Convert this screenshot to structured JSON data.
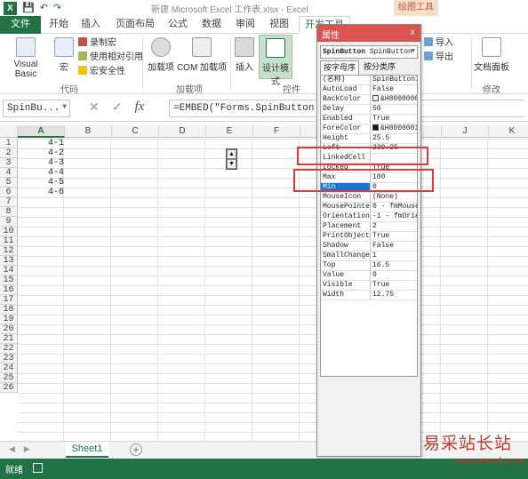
{
  "window": {
    "title": "新建 Microsoft Excel 工作表.xlsx - Excel",
    "context_tab_group": "绘图工具"
  },
  "tabs": [
    "文件",
    "开始",
    "插入",
    "页面布局",
    "公式",
    "数据",
    "审阅",
    "视图",
    "开发工具"
  ],
  "ribbon": {
    "code_group": {
      "visual_basic": "Visual Basic",
      "macros": "宏",
      "record_macro": "录制宏",
      "relative_ref": "使用相对引用",
      "macro_security": "宏安全性",
      "label": "代码"
    },
    "addins_group": {
      "addins": "加载项",
      "com_addins": "COM 加载项",
      "label": "加载项"
    },
    "controls_group": {
      "insert": "插入",
      "design_mode": "设计模式",
      "label": "控件"
    },
    "xml_group": {
      "import": "导入",
      "export": "导出"
    },
    "modify_group": {
      "doc_panel": "文档面板",
      "label": "修改"
    }
  },
  "formula_bar": {
    "name_box": "SpinBu...",
    "formula": "=EMBED(\"Forms.SpinButton.1\",\"\")"
  },
  "grid": {
    "columns": [
      "A",
      "B",
      "C",
      "D",
      "E",
      "F",
      "G",
      "H",
      "I",
      "J",
      "K"
    ],
    "rows": [
      "1",
      "2",
      "3",
      "4",
      "5",
      "6",
      "7",
      "8",
      "9",
      "10",
      "11",
      "12",
      "13",
      "14",
      "15",
      "16",
      "17",
      "18",
      "19",
      "20",
      "21",
      "22",
      "23",
      "24",
      "25",
      "26"
    ],
    "col_a_values": [
      "4-1",
      "4-2",
      "4-3",
      "4-4",
      "4-5",
      "4-6"
    ]
  },
  "sheets": {
    "active": "Sheet1",
    "add": "+"
  },
  "status": {
    "ready": "就绪"
  },
  "properties": {
    "title": "属性",
    "close": "x",
    "object_name": "SpinButton",
    "object_type": "SpinButton",
    "tab_alpha": "按字母序",
    "tab_category": "按分类序",
    "rows": [
      {
        "name": "(名称)",
        "value": "SpinButton1"
      },
      {
        "name": "AutoLoad",
        "value": "False"
      },
      {
        "name": "BackColor",
        "value": "&H8000000"
      },
      {
        "name": "Delay",
        "value": "50"
      },
      {
        "name": "Enabled",
        "value": "True"
      },
      {
        "name": "ForeColor",
        "value": "&H8000001"
      },
      {
        "name": "Height",
        "value": "25.5"
      },
      {
        "name": "Left",
        "value": "239.25"
      },
      {
        "name": "LinkedCell",
        "value": ""
      },
      {
        "name": "Locked",
        "value": "True"
      },
      {
        "name": "Max",
        "value": "100"
      },
      {
        "name": "Min",
        "value": "0"
      },
      {
        "name": "MouseIcon",
        "value": "(None)"
      },
      {
        "name": "MousePointer",
        "value": "0 - fmMouseP"
      },
      {
        "name": "Orientation",
        "value": "-1 - fmOrien"
      },
      {
        "name": "Placement",
        "value": "2"
      },
      {
        "name": "PrintObject",
        "value": "True"
      },
      {
        "name": "Shadow",
        "value": "False"
      },
      {
        "name": "SmallChange",
        "value": "1"
      },
      {
        "name": "Top",
        "value": "16.5"
      },
      {
        "name": "Value",
        "value": "0"
      },
      {
        "name": "Visible",
        "value": "True"
      },
      {
        "name": "Width",
        "value": "12.75"
      }
    ]
  },
  "watermark": {
    "text": "易采站长站",
    "url": "www.easck.com"
  },
  "colors": {
    "excel_green": "#217346",
    "highlight_red": "#e03c3c",
    "props_title": "#d9534f"
  }
}
